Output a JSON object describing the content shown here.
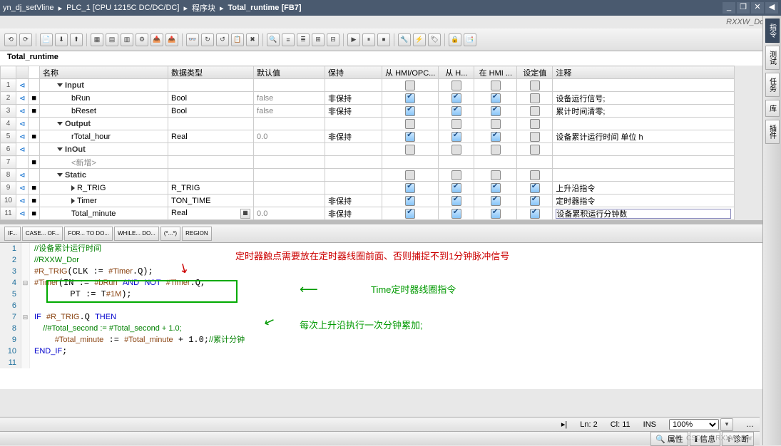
{
  "breadcrumbs": [
    "yn_dj_setVline",
    "PLC_1 [CPU 1215C DC/DC/DC]",
    "程序块",
    "Total_runtime [FB7]"
  ],
  "signature": "RXXW_Dor",
  "blockName": "Total_runtime",
  "columns": {
    "name": "名称",
    "type": "数据类型",
    "default": "默认值",
    "retain": "保持",
    "hmi1": "从 HMI/OPC...",
    "hmi2": "从 H...",
    "hmi3": "在 HMI ...",
    "setval": "设定值",
    "comment": "注释"
  },
  "rows": [
    {
      "n": "1",
      "sec": true,
      "name": "Input"
    },
    {
      "n": "2",
      "name": "bRun",
      "type": "Bool",
      "def": "false",
      "retain": "非保持",
      "c1": true,
      "c2": true,
      "c3": true,
      "sv": false,
      "cmt": "设备运行信号;"
    },
    {
      "n": "3",
      "name": "bReset",
      "type": "Bool",
      "def": "false",
      "retain": "非保持",
      "c1": true,
      "c2": true,
      "c3": true,
      "sv": false,
      "cmt": "累计时间清零;"
    },
    {
      "n": "4",
      "sec": true,
      "name": "Output"
    },
    {
      "n": "5",
      "name": "rTotal_hour",
      "type": "Real",
      "def": "0.0",
      "retain": "非保持",
      "c1": true,
      "c2": true,
      "c3": true,
      "sv": false,
      "cmt": "设备累计运行时间 单位 h"
    },
    {
      "n": "6",
      "sec": true,
      "name": "InOut"
    },
    {
      "n": "7",
      "new": true,
      "name": "<新增>"
    },
    {
      "n": "8",
      "sec": true,
      "name": "Static"
    },
    {
      "n": "9",
      "arrow": true,
      "name": "R_TRIG",
      "type": "R_TRIG",
      "def": "",
      "retain": "",
      "c1": true,
      "c2": true,
      "c3": true,
      "sv": true,
      "cmt": "上升沿指令"
    },
    {
      "n": "10",
      "arrow": true,
      "name": "Timer",
      "type": "TON_TIME",
      "def": "",
      "retain": "非保持",
      "c1": true,
      "c2": true,
      "c3": true,
      "sv": true,
      "cmt": "定时器指令"
    },
    {
      "n": "11",
      "name": "Total_minute",
      "type": "Real",
      "def": "0.0",
      "retain": "非保持",
      "c1": true,
      "c2": true,
      "c3": true,
      "sv": true,
      "cmt": "设备累积运行分钟数",
      "editing": true
    }
  ],
  "snippets": [
    "IF...",
    "CASE... OF...",
    "FOR... TO DO...",
    "WHILE... DO...",
    "(*...*)",
    "REGION"
  ],
  "code": [
    {
      "n": "1",
      "cmt": "//设备累计运行时间"
    },
    {
      "n": "2",
      "cmt": "//RXXW_Dor"
    },
    {
      "n": "3",
      "txt": "#R_TRIG(CLK := #Timer.Q);"
    },
    {
      "n": "4",
      "fold": "⊟",
      "txt": "#Timer(IN := #bRun AND NOT #Timer.Q,"
    },
    {
      "n": "5",
      "txt": "       PT := T#1M);"
    },
    {
      "n": "6",
      "txt": ""
    },
    {
      "n": "7",
      "fold": "⊟",
      "txt": "IF #R_TRIG.Q THEN"
    },
    {
      "n": "8",
      "cmt": "    //#Total_second := #Total_second + 1.0;"
    },
    {
      "n": "9",
      "txt": "    #Total_minute := #Total_minute + 1.0;",
      "tail": "//累计分钟"
    },
    {
      "n": "10",
      "txt": "END_IF;"
    },
    {
      "n": "11",
      "txt": ""
    }
  ],
  "annotations": {
    "red": "定时器触点需要放在定时器线圈前面、否则捕捉不到1分钟脉冲信号",
    "green1": "Time定时器线圈指令",
    "green2": "每次上升沿执行一次分钟累加;"
  },
  "status": {
    "ln": "Ln: 2",
    "cl": "Cl: 11",
    "ins": "INS",
    "zoom": "100%"
  },
  "bottomTabs": [
    "属性",
    "信息",
    "诊断"
  ],
  "sideTabs": [
    "指令",
    "测试",
    "任务",
    "库",
    "插件"
  ],
  "watermark": "CSDN @RXXW_Dor"
}
